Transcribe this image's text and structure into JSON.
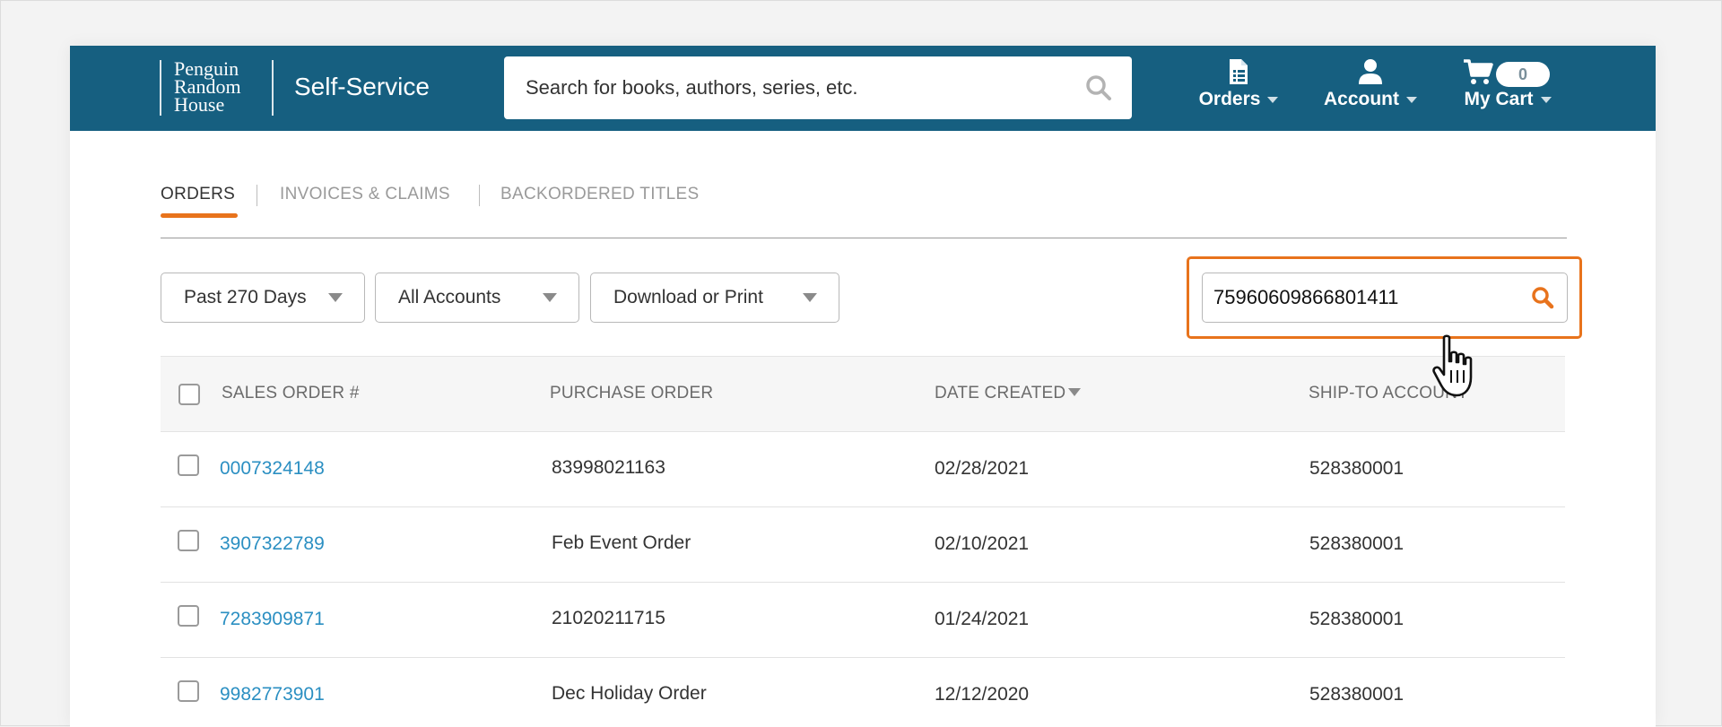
{
  "header": {
    "logo_lines": [
      "Penguin",
      "Random",
      "House"
    ],
    "title": "Self-Service",
    "search_placeholder": "Search for books, authors, series, etc.",
    "nav": [
      {
        "label": "Orders",
        "icon": "document-icon"
      },
      {
        "label": "Account",
        "icon": "user-icon"
      },
      {
        "label": "My Cart",
        "icon": "cart-icon"
      }
    ],
    "cart_count": "0",
    "bg_color": "#165f80"
  },
  "tabs": [
    {
      "label": "ORDERS",
      "active": true
    },
    {
      "label": "INVOICES & CLAIMS",
      "active": false
    },
    {
      "label": "BACKORDERED TITLES",
      "active": false
    }
  ],
  "filters": {
    "date_range": "Past 270 Days",
    "accounts": "All Accounts",
    "export": "Download or Print"
  },
  "order_search": {
    "value": "75960609866801411",
    "highlight_color": "#e8731c"
  },
  "table": {
    "columns": [
      "SALES ORDER #",
      "PURCHASE ORDER",
      "DATE CREATED",
      "SHIP-TO ACCOUNT"
    ],
    "rows": [
      {
        "sales_order": "0007324148",
        "purchase_order": "83998021163",
        "date_created": "02/28/2021",
        "ship_to": "528380001"
      },
      {
        "sales_order": "3907322789",
        "purchase_order": "Feb Event Order",
        "date_created": "02/10/2021",
        "ship_to": "528380001"
      },
      {
        "sales_order": "7283909871",
        "purchase_order": "21020211715",
        "date_created": "01/24/2021",
        "ship_to": "528380001"
      },
      {
        "sales_order": "9982773901",
        "purchase_order": "Dec Holiday Order",
        "date_created": "12/12/2020",
        "ship_to": "528380001"
      }
    ]
  }
}
